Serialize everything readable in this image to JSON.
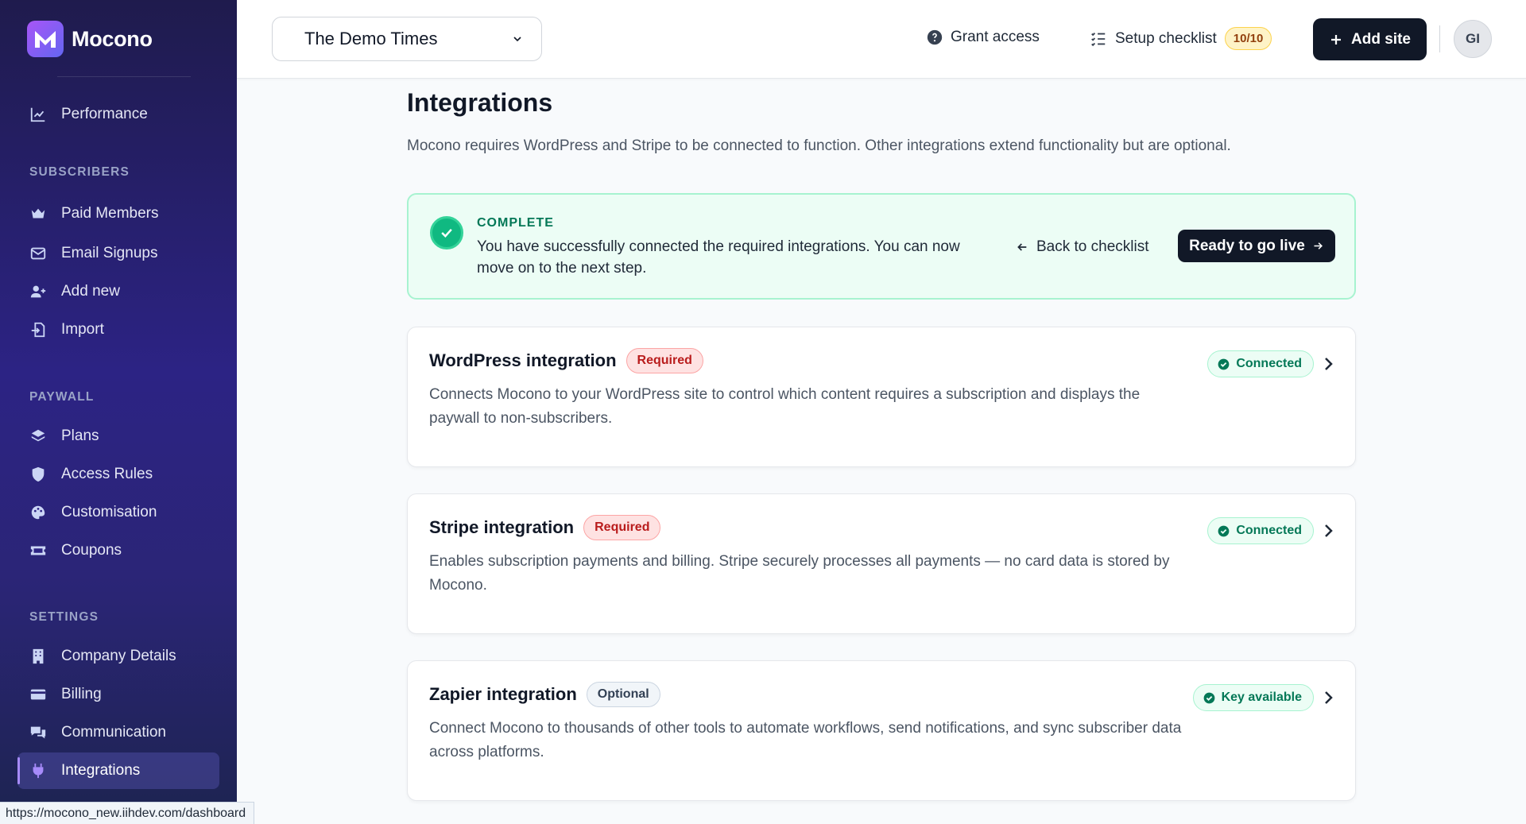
{
  "app": {
    "name": "Mocono"
  },
  "sidebar": {
    "top_items": [
      {
        "label": "Performance",
        "icon": "chart-line-icon"
      }
    ],
    "sections": [
      {
        "label": "SUBSCRIBERS",
        "items": [
          {
            "label": "Paid Members",
            "icon": "crown-icon"
          },
          {
            "label": "Email Signups",
            "icon": "envelope-icon"
          },
          {
            "label": "Add new",
            "icon": "user-plus-icon"
          },
          {
            "label": "Import",
            "icon": "file-import-icon"
          }
        ]
      },
      {
        "label": "PAYWALL",
        "items": [
          {
            "label": "Plans",
            "icon": "layers-icon"
          },
          {
            "label": "Access Rules",
            "icon": "shield-icon"
          },
          {
            "label": "Customisation",
            "icon": "palette-icon"
          },
          {
            "label": "Coupons",
            "icon": "ticket-icon"
          }
        ]
      },
      {
        "label": "SETTINGS",
        "items": [
          {
            "label": "Company Details",
            "icon": "building-icon"
          },
          {
            "label": "Billing",
            "icon": "credit-card-icon"
          },
          {
            "label": "Communication",
            "icon": "chat-bubbles-icon"
          },
          {
            "label": "Integrations",
            "icon": "plug-icon",
            "active": true
          }
        ]
      }
    ]
  },
  "header": {
    "site_selector": "The Demo Times",
    "grant_access": "Grant access",
    "setup_checklist": "Setup checklist",
    "checklist_progress": "10/10",
    "add_site": "Add site",
    "avatar_initials": "GI"
  },
  "page": {
    "title": "Integrations",
    "description": "Mocono requires WordPress and Stripe to be connected to function. Other integrations extend functionality but are optional."
  },
  "complete_banner": {
    "label": "COMPLETE",
    "message": "You have successfully connected the required integrations. You can now move on to the next step.",
    "back_link": "Back to checklist",
    "primary_button": "Ready to go live"
  },
  "integrations": [
    {
      "title": "WordPress integration",
      "tag": "Required",
      "status": "Connected",
      "description": "Connects Mocono to your WordPress site to control which content requires a subscription and displays the paywall to non-subscribers."
    },
    {
      "title": "Stripe integration",
      "tag": "Required",
      "status": "Connected",
      "description": "Enables subscription payments and billing. Stripe securely processes all payments — no card data is stored by Mocono."
    },
    {
      "title": "Zapier integration",
      "tag": "Optional",
      "status": "Key available",
      "description": "Connect Mocono to thousands of other tools to automate workflows, send notifications, and sync subscriber data across platforms."
    }
  ],
  "browser_status_url": "https://mocono_new.iihdev.com/dashboard",
  "colors": {
    "accent": "#111827",
    "success": "#10b981",
    "sidebar": "#2c2384",
    "danger": "#b91c1c"
  }
}
